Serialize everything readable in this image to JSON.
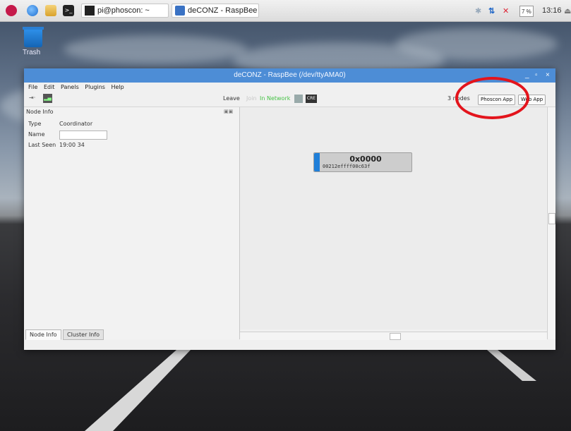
{
  "taskbar": {
    "terminal_task": "pi@phoscon: ~",
    "browser_task": "deCONZ - RaspBee (...",
    "volume": "7 %",
    "clock": "13:16"
  },
  "desktop": {
    "trash_label": "Trash"
  },
  "window": {
    "title": "deCONZ - RaspBee (/dev/ttyAMA0)",
    "menu": [
      "File",
      "Edit",
      "Panels",
      "Plugins",
      "Help"
    ],
    "toolbar": {
      "leave": "Leave",
      "join": "Join",
      "network_status": "In Network",
      "cre_badge": "CRE",
      "nodes_count": "3 nodes",
      "phoscon_app": "Phoscon App",
      "web_app": "Web App"
    },
    "node_info": {
      "panel_title": "Node Info",
      "type_label": "Type",
      "type_value": "Coordinator",
      "name_label": "Name",
      "name_value": "",
      "last_seen_label": "Last Seen",
      "last_seen_value": "19:00 34"
    },
    "tabs": [
      "Node Info",
      "Cluster Info"
    ],
    "node": {
      "address": "0x0000",
      "mac": "00212effff00c63f"
    }
  },
  "colors": {
    "titlebar": "#4d8dd6",
    "network_green": "#46c246",
    "node_stripe": "#1f7fd9",
    "highlight_circle": "#e3141c"
  }
}
